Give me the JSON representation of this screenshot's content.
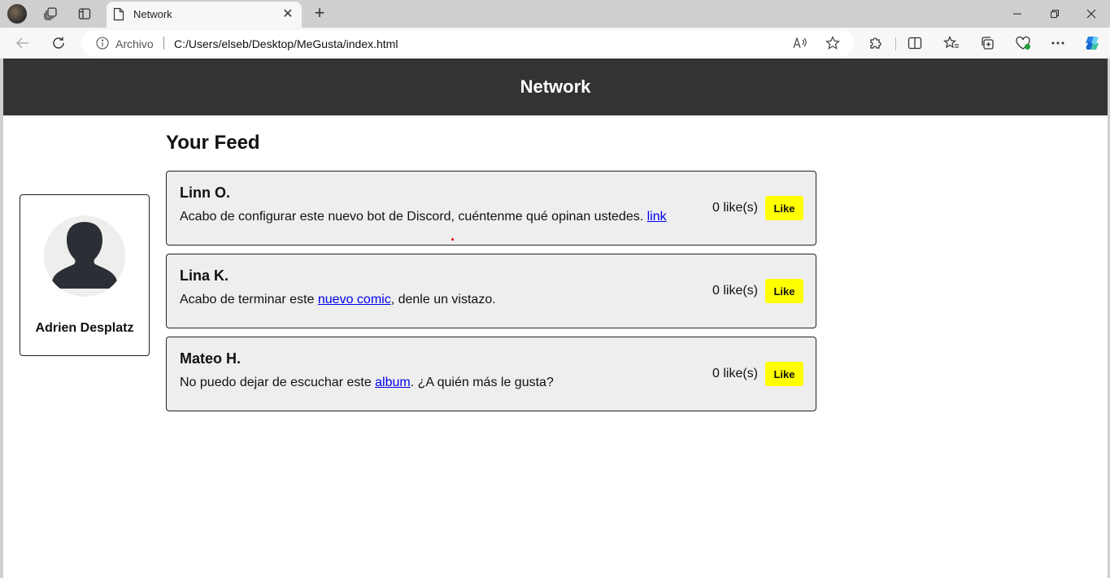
{
  "browser": {
    "tab": {
      "title": "Network"
    },
    "address": {
      "scheme_label": "Archivo",
      "url": "C:/Users/elseb/Desktop/MeGusta/index.html"
    }
  },
  "page": {
    "header_title": "Network",
    "profile": {
      "name": "Adrien Desplatz"
    },
    "feed_title": "Your Feed",
    "posts": [
      {
        "author": "Linn O.",
        "text_before": "Acabo de configurar este nuevo bot de Discord, cuéntenme qué opinan ustedes. ",
        "link_text": "link",
        "text_after": "",
        "likes_label": "0 like(s)",
        "like_button": "Like"
      },
      {
        "author": "Lina K.",
        "text_before": "Acabo de terminar este ",
        "link_text": "nuevo comic",
        "text_after": ", denle un vistazo.",
        "likes_label": "0 like(s)",
        "like_button": "Like"
      },
      {
        "author": "Mateo H.",
        "text_before": "No puedo dejar de escuchar este ",
        "link_text": "album",
        "text_after": ". ¿A quién más le gusta?",
        "likes_label": "0 like(s)",
        "like_button": "Like"
      }
    ]
  },
  "colors": {
    "header_bg": "#333333",
    "like_button_bg": "#ffff00",
    "post_bg": "#eeeeee",
    "link": "#0000ee"
  },
  "icons": [
    "profile-avatar",
    "workspaces-icon",
    "vertical-tabs-icon",
    "page-icon",
    "close-icon",
    "plus-icon",
    "minimize-icon",
    "restore-icon",
    "window-close-icon",
    "back-icon",
    "refresh-icon",
    "info-icon",
    "read-aloud-icon",
    "favorite-star-icon",
    "extensions-icon",
    "split-screen-icon",
    "favorites-icon",
    "collections-icon",
    "browser-essentials-icon",
    "more-icon",
    "copilot-icon",
    "person-silhouette-icon"
  ]
}
